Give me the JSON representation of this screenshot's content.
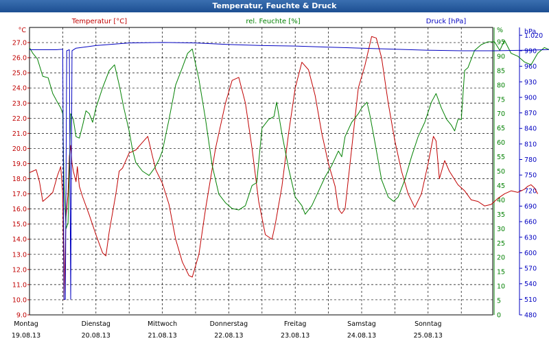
{
  "window": {
    "title": "Temperatur, Feuchte & Druck"
  },
  "colors": {
    "temperature": "#c00000",
    "humidity": "#008000",
    "pressure": "#0000c0",
    "title_bg": "#2a5fa4"
  },
  "chart_data": {
    "type": "line",
    "title": "Temperatur, Feuchte & Druck",
    "grid": true,
    "x_range": [
      0,
      7
    ],
    "x_ticks": [
      {
        "day": "Montag",
        "date": "19.08.13"
      },
      {
        "day": "Dienstag",
        "date": "20.08.13"
      },
      {
        "day": "Mittwoch",
        "date": "21.08.13"
      },
      {
        "day": "Donnerstag",
        "date": "22.08.13"
      },
      {
        "day": "Freitag",
        "date": "23.08.13"
      },
      {
        "day": "Samstag",
        "date": "24.08.13"
      },
      {
        "day": "Sonntag",
        "date": "25.08.13"
      }
    ],
    "axes": {
      "left": {
        "label": "Temperatur [°C]",
        "unit": "°C",
        "ylim": [
          9.0,
          28.0
        ],
        "ticks": [
          "9.0",
          "10.0",
          "11.0",
          "12.0",
          "13.0",
          "14.0",
          "15.0",
          "16.0",
          "17.0",
          "18.0",
          "19.0",
          "20.0",
          "21.0",
          "22.0",
          "23.0",
          "24.0",
          "25.0",
          "26.0",
          "27.0"
        ]
      },
      "mid": {
        "label": "rel. Feuchte [%]",
        "unit": "%",
        "ylim": [
          0,
          100
        ],
        "ticks": [
          "0",
          "5",
          "10",
          "15",
          "20",
          "25",
          "30",
          "35",
          "40",
          "45",
          "50",
          "55",
          "60",
          "65",
          "70",
          "75",
          "80",
          "85",
          "90",
          "95"
        ]
      },
      "right": {
        "label": "Druck [hPa]",
        "unit": "hPa",
        "ylim": [
          480,
          1035
        ],
        "ticks": [
          "480",
          "510",
          "540",
          "570",
          "600",
          "630",
          "660",
          "690",
          "720",
          "750",
          "780",
          "810",
          "840",
          "870",
          "900",
          "930",
          "960",
          "990",
          "1.020"
        ]
      }
    },
    "series": [
      {
        "name": "Temperatur [°C]",
        "axis": "left",
        "points": [
          [
            0.0,
            18.4
          ],
          [
            0.05,
            18.5
          ],
          [
            0.1,
            18.6
          ],
          [
            0.15,
            17.8
          ],
          [
            0.2,
            16.5
          ],
          [
            0.28,
            16.8
          ],
          [
            0.35,
            17.1
          ],
          [
            0.42,
            18.2
          ],
          [
            0.47,
            18.8
          ],
          [
            0.5,
            17.0
          ],
          [
            0.52,
            10.0
          ],
          [
            0.55,
            15.5
          ],
          [
            0.58,
            17.0
          ],
          [
            0.6,
            19.5
          ],
          [
            0.62,
            20.2
          ],
          [
            0.64,
            19.0
          ],
          [
            0.66,
            18.5
          ],
          [
            0.7,
            17.8
          ],
          [
            0.72,
            18.8
          ],
          [
            0.75,
            17.5
          ],
          [
            0.8,
            16.8
          ],
          [
            0.9,
            15.6
          ],
          [
            1.0,
            14.3
          ],
          [
            1.1,
            13.1
          ],
          [
            1.15,
            12.9
          ],
          [
            1.2,
            14.5
          ],
          [
            1.3,
            17.0
          ],
          [
            1.35,
            18.5
          ],
          [
            1.4,
            18.7
          ],
          [
            1.5,
            19.7
          ],
          [
            1.6,
            19.9
          ],
          [
            1.7,
            20.4
          ],
          [
            1.78,
            20.8
          ],
          [
            1.85,
            19.5
          ],
          [
            1.9,
            18.6
          ],
          [
            2.0,
            17.7
          ],
          [
            2.1,
            16.3
          ],
          [
            2.2,
            14.0
          ],
          [
            2.3,
            12.5
          ],
          [
            2.4,
            11.6
          ],
          [
            2.45,
            11.5
          ],
          [
            2.55,
            13.0
          ],
          [
            2.65,
            16.0
          ],
          [
            2.8,
            20.0
          ],
          [
            2.95,
            23.0
          ],
          [
            3.05,
            24.5
          ],
          [
            3.15,
            24.7
          ],
          [
            3.25,
            23.0
          ],
          [
            3.35,
            20.0
          ],
          [
            3.45,
            16.5
          ],
          [
            3.55,
            14.3
          ],
          [
            3.65,
            14.0
          ],
          [
            3.7,
            15.0
          ],
          [
            3.8,
            17.5
          ],
          [
            3.9,
            21.0
          ],
          [
            4.0,
            24.0
          ],
          [
            4.1,
            25.7
          ],
          [
            4.2,
            25.2
          ],
          [
            4.3,
            23.5
          ],
          [
            4.4,
            21.0
          ],
          [
            4.5,
            19.0
          ],
          [
            4.6,
            17.5
          ],
          [
            4.65,
            16.0
          ],
          [
            4.7,
            15.7
          ],
          [
            4.75,
            16.0
          ],
          [
            4.85,
            20.0
          ],
          [
            4.95,
            24.0
          ],
          [
            5.05,
            25.5
          ],
          [
            5.15,
            27.4
          ],
          [
            5.22,
            27.3
          ],
          [
            5.3,
            26.0
          ],
          [
            5.4,
            23.0
          ],
          [
            5.5,
            20.5
          ],
          [
            5.6,
            18.5
          ],
          [
            5.7,
            17.0
          ],
          [
            5.8,
            16.1
          ],
          [
            5.9,
            17.0
          ],
          [
            6.0,
            19.0
          ],
          [
            6.08,
            20.8
          ],
          [
            6.12,
            20.5
          ],
          [
            6.17,
            18.0
          ],
          [
            6.25,
            19.2
          ],
          [
            6.32,
            18.5
          ],
          [
            6.45,
            17.6
          ],
          [
            6.55,
            17.2
          ],
          [
            6.65,
            16.6
          ],
          [
            6.75,
            16.5
          ],
          [
            6.85,
            16.2
          ],
          [
            6.95,
            16.3
          ],
          [
            7.05,
            16.7
          ],
          [
            7.15,
            17.0
          ],
          [
            7.25,
            17.2
          ],
          [
            7.35,
            17.1
          ],
          [
            7.45,
            17.3
          ],
          [
            7.5,
            17.5
          ],
          [
            7.55,
            17.6
          ],
          [
            7.6,
            17.4
          ],
          [
            7.65,
            17.0
          ]
        ]
      },
      {
        "name": "rel. Feuchte [%]",
        "axis": "mid",
        "points": [
          [
            0.0,
            93.0
          ],
          [
            0.05,
            91.0
          ],
          [
            0.12,
            89.0
          ],
          [
            0.2,
            83.0
          ],
          [
            0.28,
            82.5
          ],
          [
            0.35,
            77.0
          ],
          [
            0.42,
            74.0
          ],
          [
            0.47,
            72.0
          ],
          [
            0.5,
            70.0
          ],
          [
            0.52,
            45.0
          ],
          [
            0.55,
            30.0
          ],
          [
            0.58,
            32.0
          ],
          [
            0.62,
            70.0
          ],
          [
            0.66,
            68.0
          ],
          [
            0.7,
            62.0
          ],
          [
            0.75,
            61.5
          ],
          [
            0.8,
            66.0
          ],
          [
            0.85,
            71.0
          ],
          [
            0.9,
            70.0
          ],
          [
            0.95,
            67.0
          ],
          [
            1.0,
            72.0
          ],
          [
            1.1,
            79.0
          ],
          [
            1.2,
            85.0
          ],
          [
            1.28,
            87.0
          ],
          [
            1.35,
            80.0
          ],
          [
            1.42,
            72.0
          ],
          [
            1.5,
            64.0
          ],
          [
            1.55,
            57.5
          ],
          [
            1.6,
            53.0
          ],
          [
            1.7,
            50.0
          ],
          [
            1.8,
            48.5
          ],
          [
            1.88,
            51.0
          ],
          [
            1.95,
            54.0
          ],
          [
            2.0,
            57.0
          ],
          [
            2.1,
            68.0
          ],
          [
            2.2,
            80.0
          ],
          [
            2.3,
            86.0
          ],
          [
            2.38,
            91.0
          ],
          [
            2.45,
            92.5
          ],
          [
            2.55,
            82.0
          ],
          [
            2.65,
            68.0
          ],
          [
            2.75,
            52.0
          ],
          [
            2.85,
            42.0
          ],
          [
            2.95,
            39.0
          ],
          [
            3.05,
            37.0
          ],
          [
            3.15,
            36.5
          ],
          [
            3.25,
            38.0
          ],
          [
            3.35,
            45.0
          ],
          [
            3.42,
            46.0
          ],
          [
            3.5,
            65.0
          ],
          [
            3.6,
            68.0
          ],
          [
            3.68,
            69.0
          ],
          [
            3.72,
            74.0
          ],
          [
            3.8,
            63.0
          ],
          [
            3.9,
            51.0
          ],
          [
            4.0,
            41.0
          ],
          [
            4.1,
            38.0
          ],
          [
            4.15,
            35.0
          ],
          [
            4.25,
            38.0
          ],
          [
            4.35,
            43.0
          ],
          [
            4.45,
            48.0
          ],
          [
            4.55,
            52.0
          ],
          [
            4.65,
            57.0
          ],
          [
            4.7,
            55.0
          ],
          [
            4.75,
            62.0
          ],
          [
            4.85,
            67.0
          ],
          [
            4.95,
            70.0
          ],
          [
            5.0,
            72.0
          ],
          [
            5.08,
            74.0
          ],
          [
            5.12,
            70.0
          ],
          [
            5.2,
            60.0
          ],
          [
            5.3,
            47.0
          ],
          [
            5.4,
            41.0
          ],
          [
            5.48,
            39.5
          ],
          [
            5.55,
            41.0
          ],
          [
            5.65,
            47.0
          ],
          [
            5.75,
            55.0
          ],
          [
            5.85,
            62.0
          ],
          [
            5.95,
            67.0
          ],
          [
            6.05,
            74.0
          ],
          [
            6.12,
            77.0
          ],
          [
            6.2,
            72.0
          ],
          [
            6.28,
            68.0
          ],
          [
            6.35,
            66.0
          ],
          [
            6.4,
            64.0
          ],
          [
            6.45,
            68.0
          ],
          [
            6.5,
            68.0
          ],
          [
            6.55,
            85.0
          ],
          [
            6.6,
            86.0
          ],
          [
            6.7,
            92.0
          ],
          [
            6.8,
            94.0
          ],
          [
            6.9,
            95.0
          ],
          [
            7.0,
            95.0
          ],
          [
            7.08,
            92.0
          ],
          [
            7.15,
            95.5
          ],
          [
            7.25,
            91.0
          ],
          [
            7.35,
            90.0
          ],
          [
            7.45,
            88.0
          ],
          [
            7.55,
            87.0
          ],
          [
            7.65,
            91.0
          ],
          [
            7.75,
            93.0
          ],
          [
            7.85,
            92.0
          ],
          [
            7.95,
            91.0
          ],
          [
            8.05,
            94.0
          ],
          [
            8.1,
            95.0
          ]
        ]
      },
      {
        "name": "Druck [hPa]",
        "axis": "right",
        "points": [
          [
            0.0,
            992.0
          ],
          [
            0.2,
            992.0
          ],
          [
            0.4,
            992.0
          ],
          [
            0.5,
            993.0
          ],
          [
            0.52,
            510.0
          ],
          [
            0.54,
            510.0
          ],
          [
            0.56,
            990.0
          ],
          [
            0.6,
            992.0
          ],
          [
            0.62,
            510.0
          ],
          [
            0.64,
            990.0
          ],
          [
            0.7,
            995.0
          ],
          [
            1.0,
            1000.0
          ],
          [
            1.5,
            1005.0
          ],
          [
            2.0,
            1006.0
          ],
          [
            2.5,
            1005.0
          ],
          [
            3.0,
            1002.0
          ],
          [
            3.5,
            1000.0
          ],
          [
            4.0,
            999.0
          ],
          [
            4.5,
            997.0
          ],
          [
            5.0,
            995.0
          ],
          [
            5.5,
            993.0
          ],
          [
            6.0,
            991.0
          ],
          [
            6.5,
            990.0
          ],
          [
            7.0,
            990.0
          ],
          [
            7.5,
            991.0
          ],
          [
            8.0,
            993.0
          ],
          [
            8.1,
            995.0
          ]
        ]
      }
    ]
  }
}
